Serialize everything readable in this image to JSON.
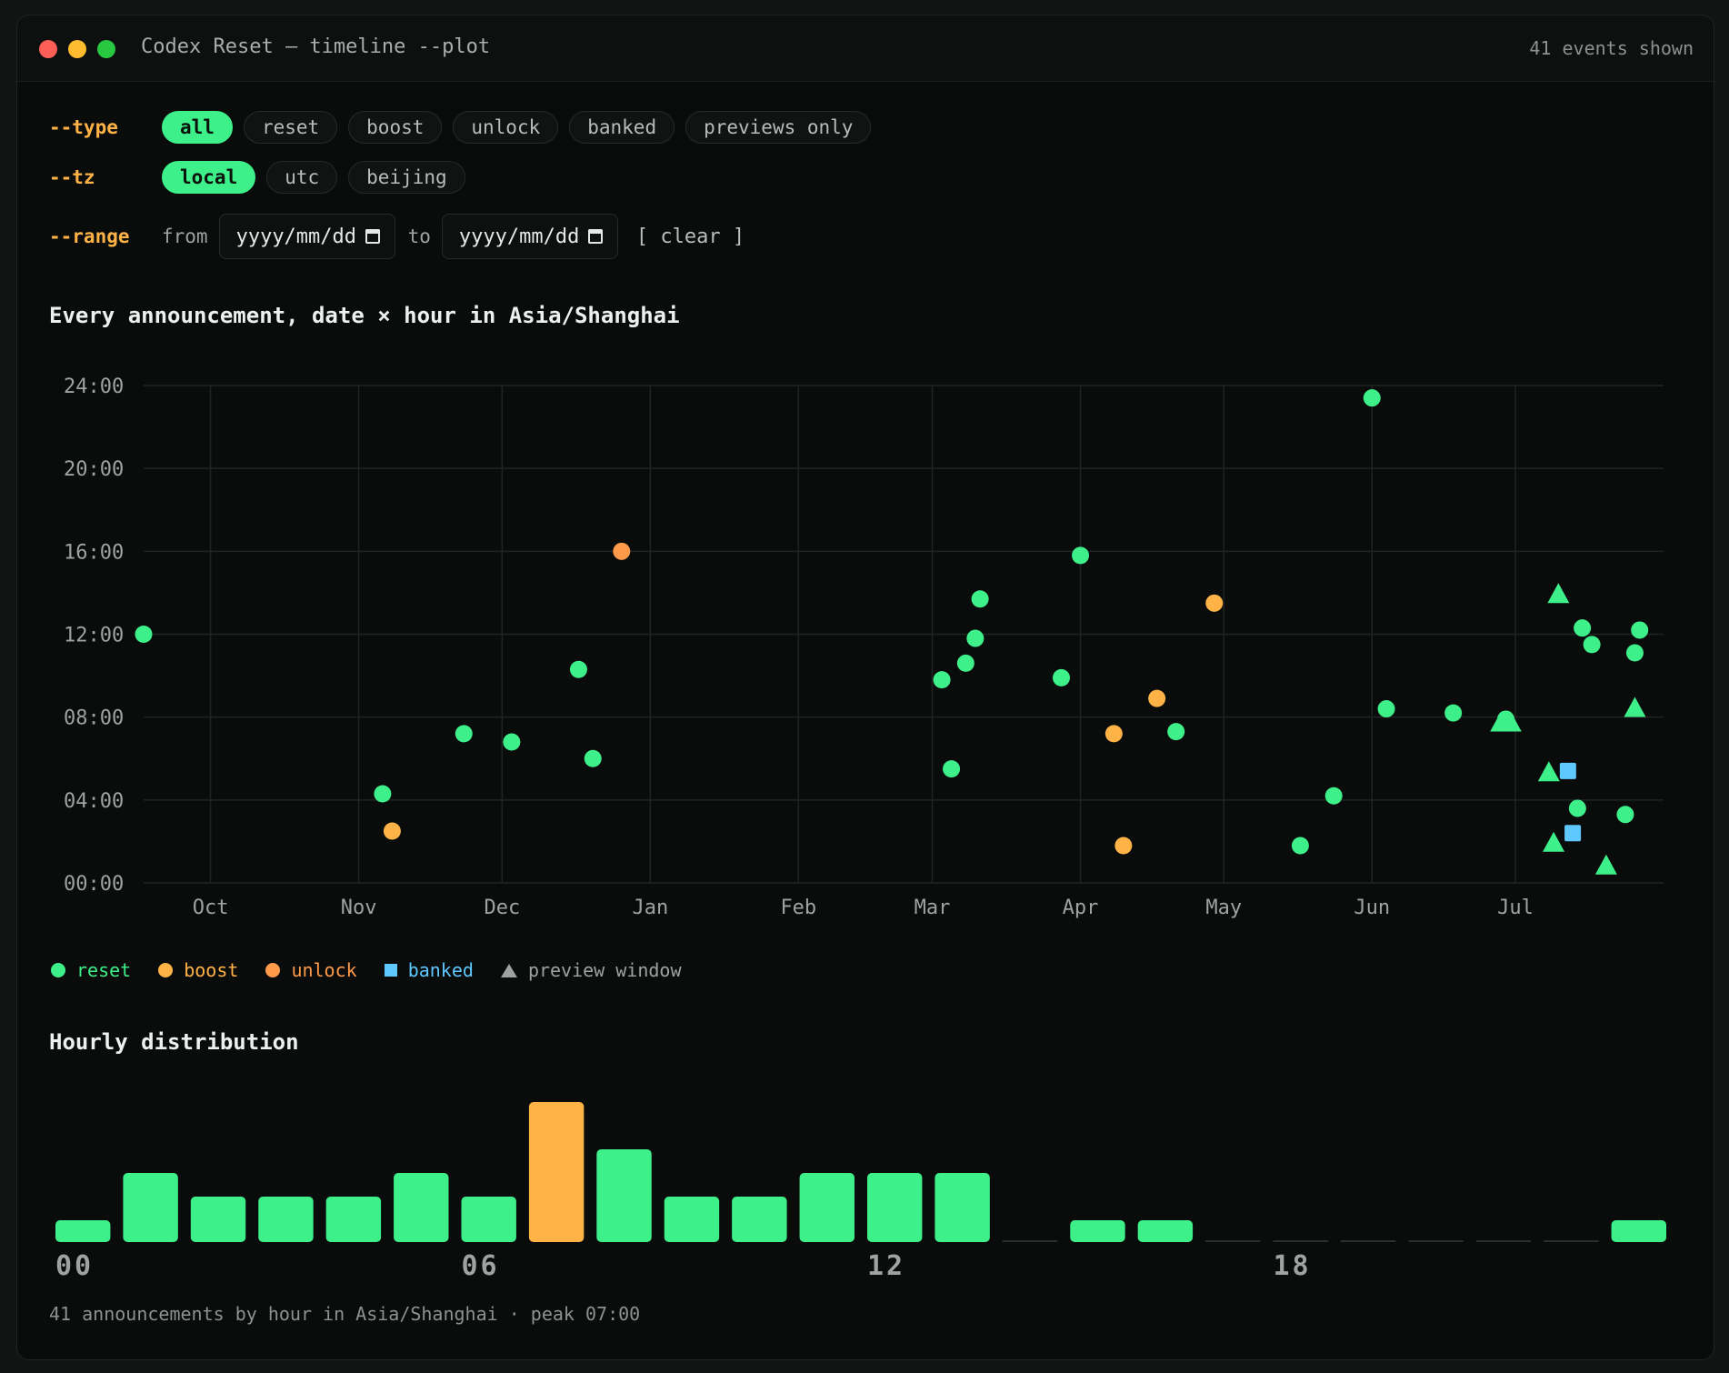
{
  "window": {
    "title": "Codex Reset — timeline --plot",
    "events_shown": "41 events shown"
  },
  "filters": {
    "type": {
      "flag": "--type",
      "options": [
        "all",
        "reset",
        "boost",
        "unlock",
        "banked",
        "previews only"
      ],
      "active": "all"
    },
    "tz": {
      "flag": "--tz",
      "options": [
        "local",
        "utc",
        "beijing"
      ],
      "active": "local"
    },
    "range": {
      "flag": "--range",
      "from_label": "from",
      "to_label": "to",
      "from_placeholder": "yyyy/mm/dd",
      "to_placeholder": "yyyy/mm/dd",
      "clear_label": "[ clear ]"
    }
  },
  "colors": {
    "reset": "#3ef08a",
    "boost": "#ffb347",
    "unlock": "#ff9a4a",
    "banked": "#5ec8ff",
    "preview": "#3ef08a",
    "grid": "#1f2522",
    "axis_text": "#9ea39f"
  },
  "legend": [
    {
      "key": "reset",
      "label": "reset",
      "shape": "circle",
      "color": "#3ef08a"
    },
    {
      "key": "boost",
      "label": "boost",
      "shape": "circle",
      "color": "#ffb347"
    },
    {
      "key": "unlock",
      "label": "unlock",
      "shape": "circle",
      "color": "#ff9a4a"
    },
    {
      "key": "banked",
      "label": "banked",
      "shape": "square",
      "color": "#5ec8ff"
    },
    {
      "key": "preview",
      "label": "preview window",
      "shape": "triangle",
      "color": "#9ea39f"
    }
  ],
  "chart_data": [
    {
      "type": "scatter",
      "title": "Every announcement, date × hour in Asia/Shanghai",
      "x_ticks": [
        "Oct",
        "Nov",
        "Dec",
        "Jan",
        "Feb",
        "Mar",
        "Apr",
        "May",
        "Jun",
        "Jul"
      ],
      "x_tick_dates": [
        "2025-10-01",
        "2025-11-01",
        "2025-12-01",
        "2026-01-01",
        "2026-02-01",
        "2026-03-01",
        "2026-04-01",
        "2026-05-01",
        "2026-06-01",
        "2026-07-01"
      ],
      "xlim": [
        "2025-09-17",
        "2026-08-01"
      ],
      "y_ticks": [
        "00:00",
        "04:00",
        "08:00",
        "12:00",
        "16:00",
        "20:00",
        "24:00"
      ],
      "ylim": [
        0,
        24
      ],
      "grid": true,
      "points": [
        {
          "date": "2025-09-17",
          "hour": 12.0,
          "kind": "reset"
        },
        {
          "date": "2025-11-06",
          "hour": 4.3,
          "kind": "reset"
        },
        {
          "date": "2025-11-08",
          "hour": 2.5,
          "kind": "boost"
        },
        {
          "date": "2025-11-23",
          "hour": 7.2,
          "kind": "reset"
        },
        {
          "date": "2025-12-03",
          "hour": 6.8,
          "kind": "reset"
        },
        {
          "date": "2025-12-17",
          "hour": 10.3,
          "kind": "reset"
        },
        {
          "date": "2025-12-20",
          "hour": 6.0,
          "kind": "reset"
        },
        {
          "date": "2025-12-26",
          "hour": 16.0,
          "kind": "unlock"
        },
        {
          "date": "2026-03-03",
          "hour": 9.8,
          "kind": "reset"
        },
        {
          "date": "2026-03-05",
          "hour": 5.5,
          "kind": "reset"
        },
        {
          "date": "2026-03-08",
          "hour": 10.6,
          "kind": "reset"
        },
        {
          "date": "2026-03-10",
          "hour": 11.8,
          "kind": "reset"
        },
        {
          "date": "2026-03-11",
          "hour": 13.7,
          "kind": "reset"
        },
        {
          "date": "2026-03-28",
          "hour": 9.9,
          "kind": "reset"
        },
        {
          "date": "2026-04-01",
          "hour": 15.8,
          "kind": "reset"
        },
        {
          "date": "2026-04-08",
          "hour": 7.2,
          "kind": "boost"
        },
        {
          "date": "2026-04-10",
          "hour": 1.8,
          "kind": "boost"
        },
        {
          "date": "2026-04-17",
          "hour": 8.9,
          "kind": "boost"
        },
        {
          "date": "2026-04-21",
          "hour": 7.3,
          "kind": "reset"
        },
        {
          "date": "2026-04-29",
          "hour": 13.5,
          "kind": "boost"
        },
        {
          "date": "2026-05-17",
          "hour": 1.8,
          "kind": "reset"
        },
        {
          "date": "2026-05-24",
          "hour": 4.2,
          "kind": "reset"
        },
        {
          "date": "2026-06-01",
          "hour": 23.4,
          "kind": "reset"
        },
        {
          "date": "2026-06-04",
          "hour": 8.4,
          "kind": "reset"
        },
        {
          "date": "2026-06-18",
          "hour": 8.2,
          "kind": "reset"
        },
        {
          "date": "2026-06-28",
          "hour": 7.7,
          "kind": "preview"
        },
        {
          "date": "2026-06-29",
          "hour": 7.9,
          "kind": "reset"
        },
        {
          "date": "2026-06-30",
          "hour": 7.7,
          "kind": "preview"
        },
        {
          "date": "2026-07-08",
          "hour": 5.3,
          "kind": "preview"
        },
        {
          "date": "2026-07-09",
          "hour": 1.9,
          "kind": "preview"
        },
        {
          "date": "2026-07-10",
          "hour": 13.9,
          "kind": "preview"
        },
        {
          "date": "2026-07-12",
          "hour": 5.4,
          "kind": "banked"
        },
        {
          "date": "2026-07-13",
          "hour": 2.4,
          "kind": "banked"
        },
        {
          "date": "2026-07-14",
          "hour": 3.6,
          "kind": "reset"
        },
        {
          "date": "2026-07-15",
          "hour": 12.3,
          "kind": "reset"
        },
        {
          "date": "2026-07-17",
          "hour": 11.5,
          "kind": "reset"
        },
        {
          "date": "2026-07-20",
          "hour": 0.8,
          "kind": "preview"
        },
        {
          "date": "2026-07-24",
          "hour": 3.3,
          "kind": "reset"
        },
        {
          "date": "2026-07-26",
          "hour": 11.1,
          "kind": "reset"
        },
        {
          "date": "2026-07-26",
          "hour": 8.4,
          "kind": "preview"
        },
        {
          "date": "2026-07-27",
          "hour": 12.2,
          "kind": "reset"
        }
      ]
    },
    {
      "type": "bar",
      "title": "Hourly distribution",
      "categories": [
        "00",
        "01",
        "02",
        "03",
        "04",
        "05",
        "06",
        "07",
        "08",
        "09",
        "10",
        "11",
        "12",
        "13",
        "14",
        "15",
        "16",
        "17",
        "18",
        "19",
        "20",
        "21",
        "22",
        "23"
      ],
      "x_tick_labels": [
        "00",
        "06",
        "12",
        "18"
      ],
      "values": [
        1,
        3,
        2,
        2,
        2,
        3,
        2,
        6,
        4,
        2,
        2,
        3,
        3,
        3,
        0,
        1,
        1,
        0,
        0,
        0,
        0,
        0,
        0,
        1
      ],
      "peak_index": 7,
      "bar_color": "#3ef08a",
      "peak_color": "#ffb347"
    }
  ],
  "hist_footer": "41 announcements by hour in Asia/Shanghai · peak 07:00"
}
